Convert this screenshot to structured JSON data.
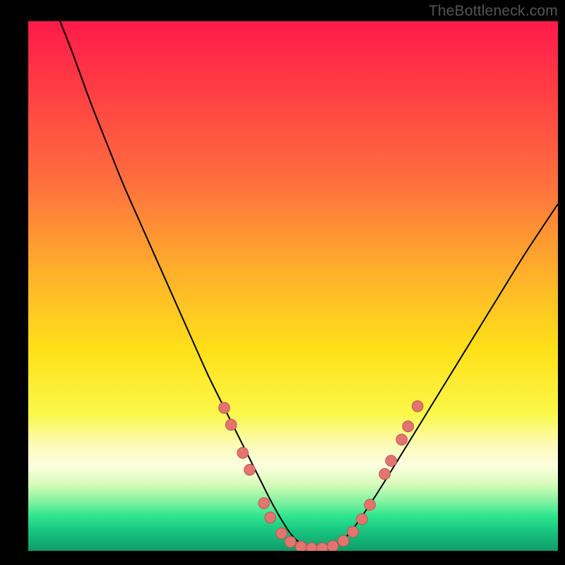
{
  "watermark": "TheBottleneck.com",
  "colors": {
    "black": "#000000",
    "curve": "#000000",
    "marker_fill": "#e4746f",
    "marker_stroke": "#b6534f"
  },
  "chart_data": {
    "type": "line",
    "title": "",
    "xlabel": "",
    "ylabel": "",
    "xlim": [
      0,
      100
    ],
    "ylim": [
      0,
      100
    ],
    "gradient_stops": [
      {
        "offset": 0.0,
        "color": "#ff1a4b"
      },
      {
        "offset": 0.12,
        "color": "#ff3b44"
      },
      {
        "offset": 0.3,
        "color": "#ff6e3e"
      },
      {
        "offset": 0.48,
        "color": "#ffb22a"
      },
      {
        "offset": 0.62,
        "color": "#ffe019"
      },
      {
        "offset": 0.74,
        "color": "#fbf748"
      },
      {
        "offset": 0.8,
        "color": "#fcfbb8"
      },
      {
        "offset": 0.84,
        "color": "#fcfee0"
      },
      {
        "offset": 0.875,
        "color": "#d6fbb8"
      },
      {
        "offset": 0.905,
        "color": "#87f3a1"
      },
      {
        "offset": 0.935,
        "color": "#2de58f"
      },
      {
        "offset": 0.965,
        "color": "#16c27d"
      },
      {
        "offset": 1.0,
        "color": "#109b67"
      }
    ],
    "series": [
      {
        "name": "bottleneck-curve",
        "x": [
          6,
          8,
          10,
          12,
          14,
          16,
          18,
          20,
          22,
          24,
          26,
          28,
          30,
          32,
          34,
          36,
          38,
          40,
          42,
          44,
          46,
          48,
          50,
          52,
          54,
          56,
          58,
          60,
          62,
          66,
          70,
          74,
          78,
          82,
          86,
          90,
          94,
          98,
          100
        ],
        "y": [
          100,
          95,
          89.5,
          84,
          79,
          74,
          69,
          64.5,
          60,
          55.5,
          51,
          46.5,
          42,
          37.5,
          33,
          29,
          25,
          21,
          17,
          13,
          9,
          5.5,
          2.5,
          1,
          0.5,
          0.5,
          1,
          2.5,
          5,
          11,
          17.5,
          24,
          30.5,
          37,
          43.5,
          50,
          56.5,
          62.5,
          65.5
        ]
      }
    ],
    "markers": {
      "name": "highlight-points",
      "points": [
        {
          "x": 37.0,
          "y": 27.0
        },
        {
          "x": 38.3,
          "y": 23.8
        },
        {
          "x": 40.5,
          "y": 18.5
        },
        {
          "x": 41.8,
          "y": 15.3
        },
        {
          "x": 44.5,
          "y": 9.0
        },
        {
          "x": 45.7,
          "y": 6.3
        },
        {
          "x": 47.8,
          "y": 3.3
        },
        {
          "x": 49.5,
          "y": 1.7
        },
        {
          "x": 51.5,
          "y": 0.8
        },
        {
          "x": 53.5,
          "y": 0.5
        },
        {
          "x": 55.5,
          "y": 0.5
        },
        {
          "x": 57.5,
          "y": 0.9
        },
        {
          "x": 59.5,
          "y": 1.9
        },
        {
          "x": 61.3,
          "y": 3.6
        },
        {
          "x": 63.0,
          "y": 6.0
        },
        {
          "x": 64.5,
          "y": 8.7
        },
        {
          "x": 67.3,
          "y": 14.5
        },
        {
          "x": 68.5,
          "y": 17.0
        },
        {
          "x": 70.5,
          "y": 21.0
        },
        {
          "x": 71.7,
          "y": 23.5
        },
        {
          "x": 73.5,
          "y": 27.3
        }
      ]
    }
  }
}
